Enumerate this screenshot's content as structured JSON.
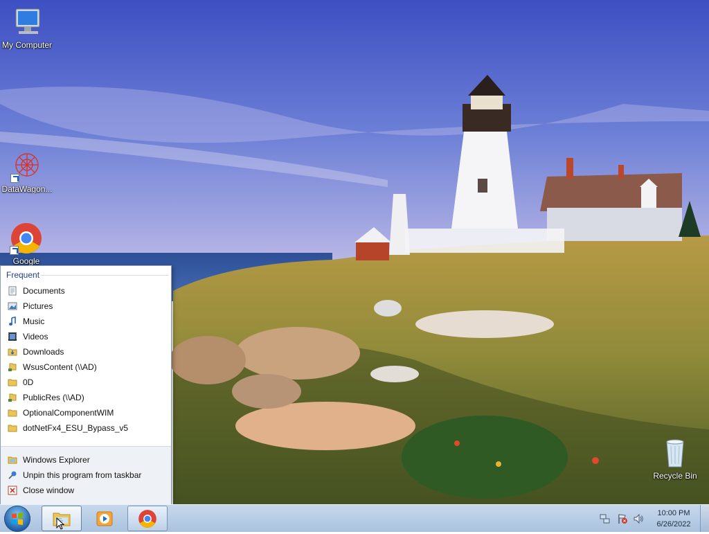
{
  "desktop": {
    "icons": [
      {
        "label": "My Computer",
        "icon": "computer-icon"
      },
      {
        "label": "DataWagon...",
        "icon": "datawagon-icon"
      },
      {
        "label": "Google",
        "icon": "chrome-icon"
      },
      {
        "label": "Recycle Bin",
        "icon": "recycle-bin-icon"
      }
    ]
  },
  "jumplist": {
    "heading": "Frequent",
    "frequent": [
      {
        "label": "Documents",
        "icon": "document-icon"
      },
      {
        "label": "Pictures",
        "icon": "pictures-icon"
      },
      {
        "label": "Music",
        "icon": "music-icon"
      },
      {
        "label": "Videos",
        "icon": "videos-icon"
      },
      {
        "label": "Downloads",
        "icon": "downloads-folder-icon"
      },
      {
        "label": "WsusContent (\\\\AD)",
        "icon": "network-folder-icon"
      },
      {
        "label": "0D",
        "icon": "folder-icon"
      },
      {
        "label": "PublicRes (\\\\AD)",
        "icon": "network-folder-icon"
      },
      {
        "label": "OptionalComponentWIM",
        "icon": "folder-icon"
      },
      {
        "label": "dotNetFx4_ESU_Bypass_v5",
        "icon": "folder-icon"
      }
    ],
    "tasks": [
      {
        "label": "Windows Explorer",
        "icon": "explorer-icon"
      },
      {
        "label": "Unpin this program from taskbar",
        "icon": "unpin-icon"
      },
      {
        "label": "Close window",
        "icon": "close-window-icon"
      }
    ]
  },
  "taskbar": {
    "buttons": [
      {
        "icon": "explorer-icon",
        "state": "active"
      },
      {
        "icon": "media-player-icon",
        "state": "pinned"
      },
      {
        "icon": "chrome-icon",
        "state": "open"
      }
    ],
    "tray_icons": [
      "network-icon",
      "action-center-flag-icon",
      "volume-icon"
    ],
    "clock": {
      "time": "10:00 PM",
      "date": "6/26/2022"
    }
  },
  "colors": {
    "accent": "#1e3f8a",
    "taskbar": "#b7cbe3"
  }
}
